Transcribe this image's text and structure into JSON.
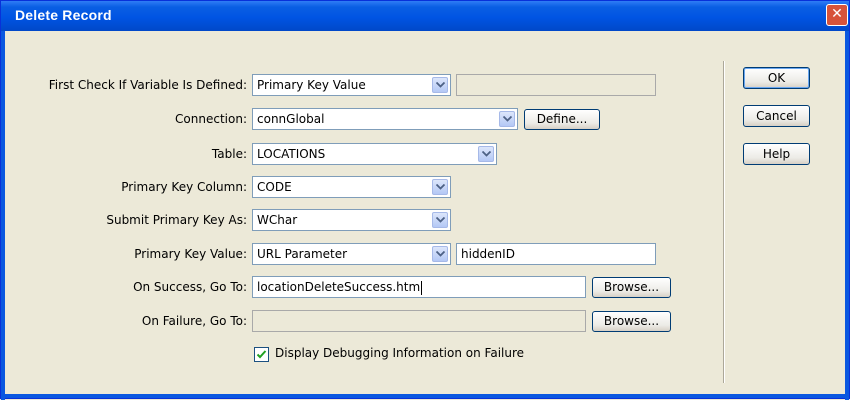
{
  "window": {
    "title": "Delete Record",
    "close_glyph": "✕"
  },
  "form": {
    "first_check": {
      "label": "First Check If Variable Is Defined:",
      "value": "Primary Key Value",
      "text_value": ""
    },
    "connection": {
      "label": "Connection:",
      "value": "connGlobal",
      "define_label": "Define..."
    },
    "table": {
      "label": "Table:",
      "value": "LOCATIONS"
    },
    "pk_column": {
      "label": "Primary Key Column:",
      "value": "CODE"
    },
    "submit_as": {
      "label": "Submit Primary Key As:",
      "value": "WChar"
    },
    "pk_value": {
      "label": "Primary Key Value:",
      "value": "URL Parameter",
      "text_value": "hiddenID"
    },
    "on_success": {
      "label": "On Success, Go To:",
      "value": "locationDeleteSuccess.htm",
      "browse_label": "Browse..."
    },
    "on_failure": {
      "label": "On Failure, Go To:",
      "value": "",
      "browse_label": "Browse..."
    },
    "debug": {
      "label": "Display Debugging Information on Failure",
      "checked": true
    }
  },
  "buttons": {
    "ok": "OK",
    "cancel": "Cancel",
    "help": "Help"
  },
  "colors": {
    "titlebar": "#0054e3",
    "dialog_bg": "#ece9d8",
    "input_border": "#7f9db9"
  }
}
